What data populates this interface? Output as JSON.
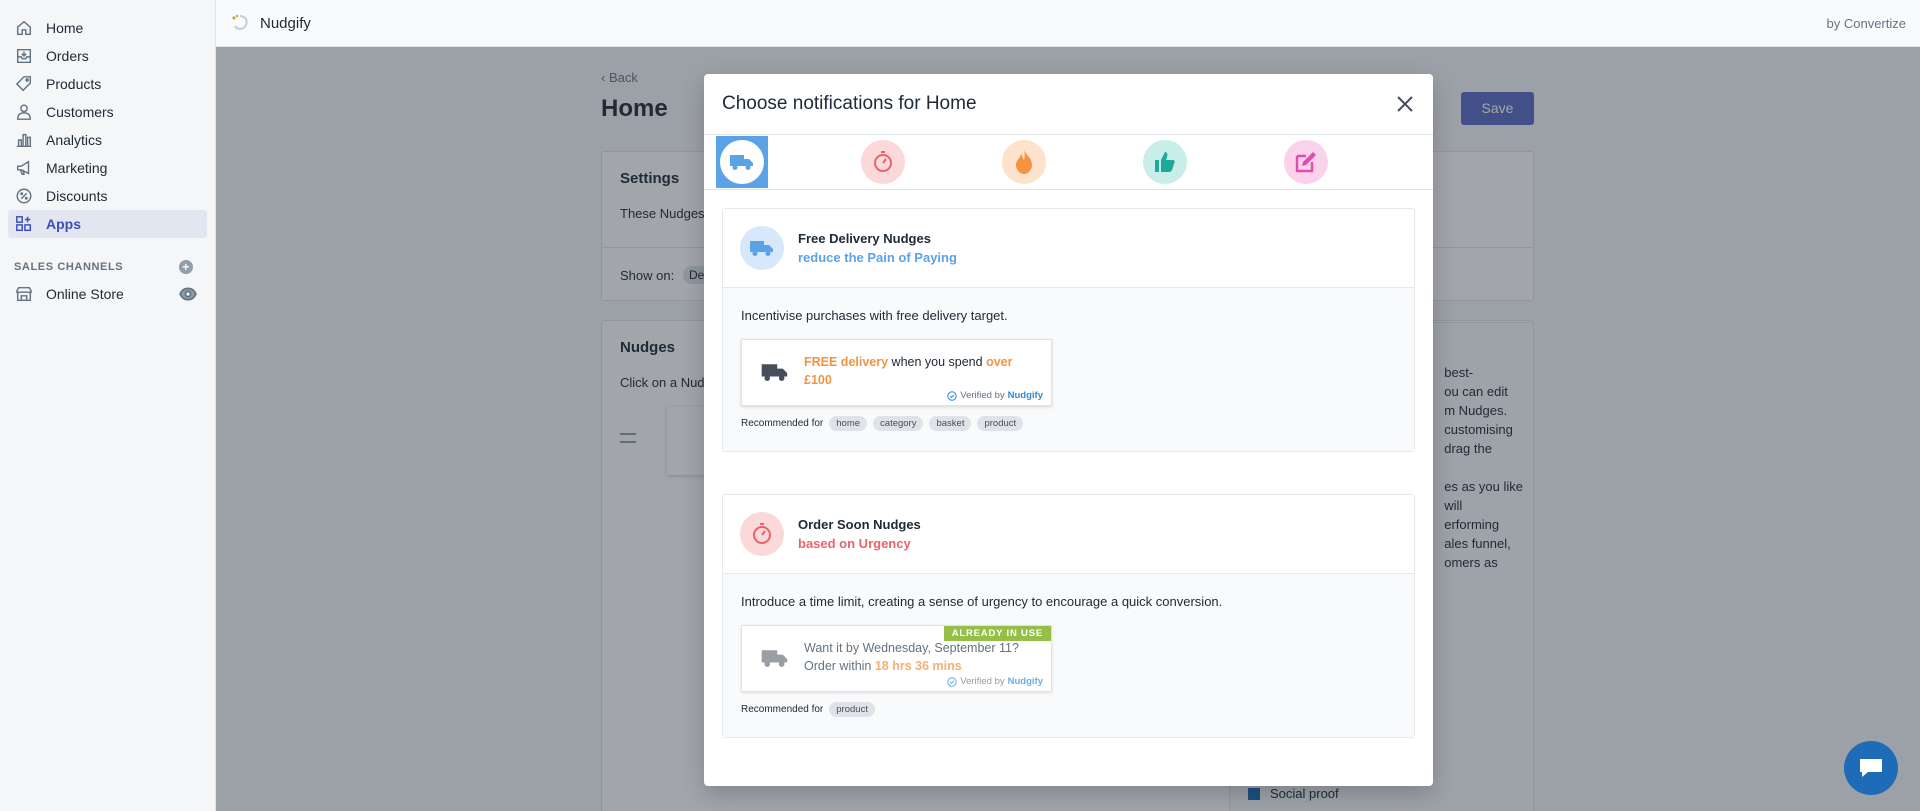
{
  "sidebar": {
    "items": [
      {
        "label": "Home",
        "icon": "home-icon"
      },
      {
        "label": "Orders",
        "icon": "orders-icon"
      },
      {
        "label": "Products",
        "icon": "tag-icon"
      },
      {
        "label": "Customers",
        "icon": "person-icon"
      },
      {
        "label": "Analytics",
        "icon": "bar-chart-icon"
      },
      {
        "label": "Marketing",
        "icon": "megaphone-icon"
      },
      {
        "label": "Discounts",
        "icon": "discount-icon"
      },
      {
        "label": "Apps",
        "icon": "apps-icon"
      }
    ],
    "sales_channels_label": "SALES CHANNELS",
    "online_store_label": "Online Store"
  },
  "topbar": {
    "app_name": "Nudgify",
    "by": "by Convertize"
  },
  "page": {
    "back": "Back",
    "title": "Home",
    "save": "Save",
    "settings_title": "Settings",
    "settings_text": "These Nudges",
    "show_on": "Show on:",
    "show_on_chip": "De",
    "nudges_title": "Nudges",
    "nudges_text": "Click on a Nud",
    "right_text": [
      "best-",
      "ou can edit",
      "m Nudges.",
      "customising",
      "drag the",
      "",
      "es as you like",
      "will",
      "erforming",
      "ales funnel,",
      "omers as"
    ],
    "social_proof": "Social proof"
  },
  "modal": {
    "title": "Choose notifications for Home",
    "tabs": [
      {
        "name": "delivery",
        "color": "#5ba3e6",
        "bg": "#ffffff"
      },
      {
        "name": "urgency",
        "color": "#e8646a",
        "bg": "#fbd8d9"
      },
      {
        "name": "fire",
        "color": "#f49342",
        "bg": "#fde3cb"
      },
      {
        "name": "thumbs-up",
        "color": "#1fa99b",
        "bg": "#c9ede8"
      },
      {
        "name": "edit",
        "color": "#e04dab",
        "bg": "#fbd2ec"
      }
    ],
    "cards": [
      {
        "title": "Free Delivery Nudges",
        "subtitle": "reduce the Pain of Paying",
        "subtitle_color": "#5ba3e6",
        "description": "Incentivise purchases with free delivery target.",
        "preview_parts": [
          "FREE delivery",
          " when you spend ",
          "over £100"
        ],
        "verified": "Verified by",
        "verified_brand": "Nudgify",
        "recommended_label": "Recommended for",
        "chips": [
          "home",
          "category",
          "basket",
          "product"
        ]
      },
      {
        "title": "Order Soon Nudges",
        "subtitle": "based on Urgency",
        "subtitle_color": "#e8646a",
        "description": "Introduce a time limit, creating a sense of urgency to encourage a quick conversion.",
        "badge": "ALREADY IN USE",
        "preview_parts": [
          "Want it by Wednesday, September 11? Order within ",
          "18 hrs 36 mins"
        ],
        "verified": "Verified by",
        "verified_brand": "Nudgify",
        "recommended_label": "Recommended for",
        "chips": [
          "product"
        ]
      }
    ]
  }
}
